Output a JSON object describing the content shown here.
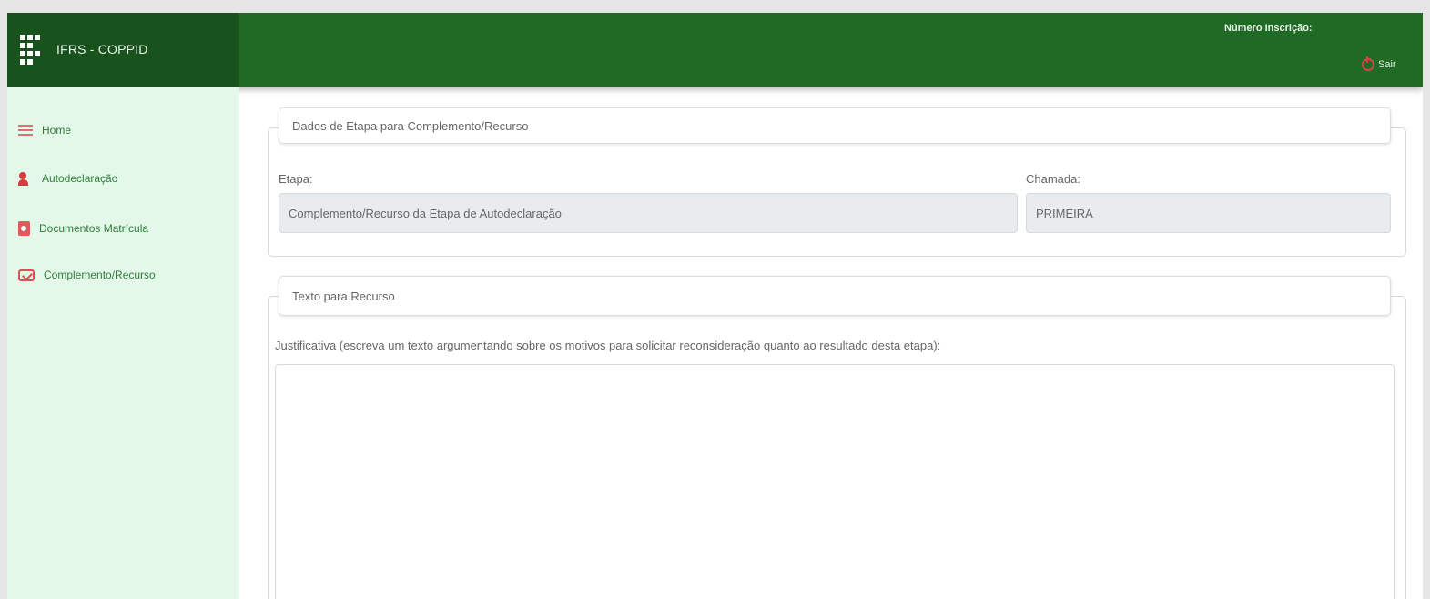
{
  "header": {
    "brand": "IFRS - COPPID",
    "inscricao_label": "Número Inscrição:",
    "logout_label": "Sair"
  },
  "sidebar": {
    "items": [
      {
        "label": "Home",
        "icon": "list-icon"
      },
      {
        "label": "Autodeclaração",
        "icon": "user-icon"
      },
      {
        "label": "Documentos Matrícula",
        "icon": "file-icon"
      },
      {
        "label": "Complemento/Recurso",
        "icon": "envelope-icon"
      }
    ]
  },
  "etapa_panel": {
    "legend": "Dados de Etapa para Complemento/Recurso",
    "etapa_label": "Etapa:",
    "etapa_value": "Complemento/Recurso da Etapa de Autodeclaração",
    "chamada_label": "Chamada:",
    "chamada_value": "PRIMEIRA"
  },
  "recurso_panel": {
    "legend": "Texto para Recurso",
    "justificativa_label": "Justificativa (escreva um texto argumentando sobre os motivos para solicitar reconsideração quanto ao resultado desta etapa):",
    "justificativa_value": ""
  },
  "colors": {
    "header": "#1f6b26",
    "brand_bg": "#18521d",
    "sidebar_bg": "#e3f8e9",
    "accent_icon": "#d83a3a"
  }
}
